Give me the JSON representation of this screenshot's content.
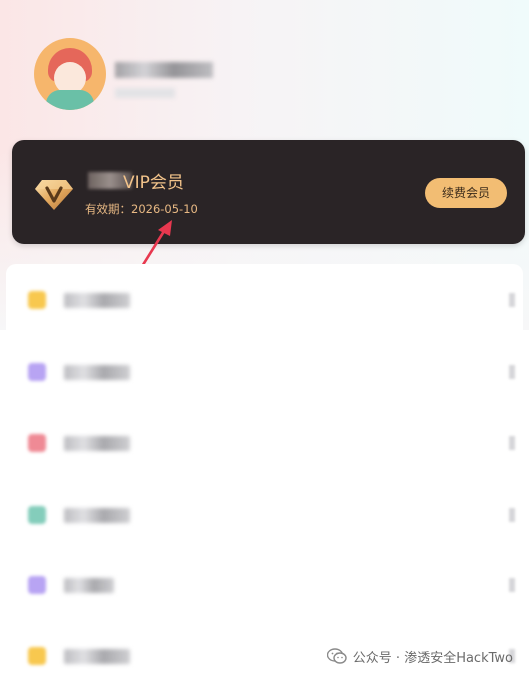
{
  "profile": {
    "avatar_icon": "avatar-icon"
  },
  "vip": {
    "title": "VIP会员",
    "expire_label": "有效期：",
    "expire_date": "2026-05-10",
    "renew_button": "续费会员",
    "icon": "diamond-v-icon"
  },
  "menu": {
    "items": [
      {
        "icon_color": "#f8c84f"
      },
      {
        "icon_color": "#b8a4f3"
      },
      {
        "icon_color": "#ef8a95"
      },
      {
        "icon_color": "#84cdbb"
      },
      {
        "icon_color": "#b8a4f3"
      },
      {
        "icon_color": "#f8c84f"
      }
    ]
  },
  "watermark": {
    "text": "公众号 · 渗透安全HackTwo",
    "icon": "wechat-icon"
  },
  "colors": {
    "card_bg": "#2a2426",
    "gold_text": "#f2c38a",
    "button_bg": "#f2bd73",
    "arrow": "#e8384f"
  }
}
